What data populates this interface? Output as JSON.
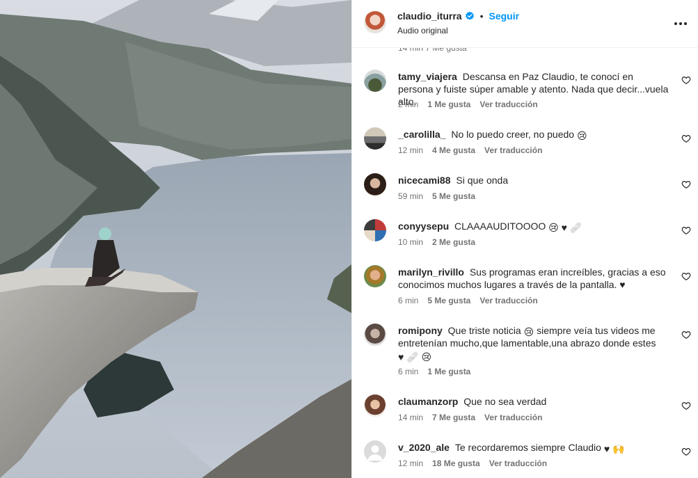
{
  "header": {
    "username": "claudio_iturra",
    "separator": "•",
    "follow_label": "Seguir",
    "audio_label": "Audio original"
  },
  "partial_meta": "14 min   7 Me gusta",
  "comments": [
    {
      "user": "tamy_viajera",
      "text": "Descansa en Paz Claudio, te conocí en persona y fuiste súper amable y atento. Nada que decir...vuela alto.",
      "time": "2 min",
      "likes": "1 Me gusta",
      "translate": "Ver traducción"
    },
    {
      "user": "_carolilla_",
      "text": "No lo puedo creer, no puedo",
      "emoji": "😢",
      "time": "12 min",
      "likes": "4 Me gusta",
      "translate": "Ver traducción"
    },
    {
      "user": "nicecami88",
      "text": "Si que onda",
      "time": "59 min",
      "likes": "5 Me gusta"
    },
    {
      "user": "conyysepu",
      "text": "CLAAAAUDITOOOO",
      "emoji": "😢 ♥ 🩹",
      "time": "10 min",
      "likes": "2 Me gusta"
    },
    {
      "user": "marilyn_rivillo",
      "text": "Sus programas eran increíbles, gracias a eso conocimos muchos lugares a través de la pantalla. ♥",
      "time": "6 min",
      "likes": "5 Me gusta",
      "translate": "Ver traducción"
    },
    {
      "user": "romipony",
      "text": "Que triste noticia",
      "emoji": "😢",
      "text2": "siempre veía tus videos me entretenían mucho,que lamentable,una abrazo donde estes",
      "emoji2": "♥ 🩹 😢",
      "time": "6 min",
      "likes": "1 Me gusta"
    },
    {
      "user": "claumanzorp",
      "text": "Que no sea verdad",
      "time": "14 min",
      "likes": "7 Me gusta",
      "translate": "Ver traducción"
    },
    {
      "user": "v_2020_ale",
      "text": "Te recordaremos siempre Claudio",
      "emoji": "♥ 🙌",
      "time": "12 min",
      "likes": "18 Me gusta",
      "translate": "Ver traducción"
    }
  ],
  "icons": {
    "verified": "verified-badge-icon",
    "heart": "heart-outline-icon",
    "more": "more-options-icon"
  },
  "colors": {
    "link": "#0095f6",
    "text": "#262626",
    "secondary": "#737373",
    "verified": "#0095f6"
  }
}
